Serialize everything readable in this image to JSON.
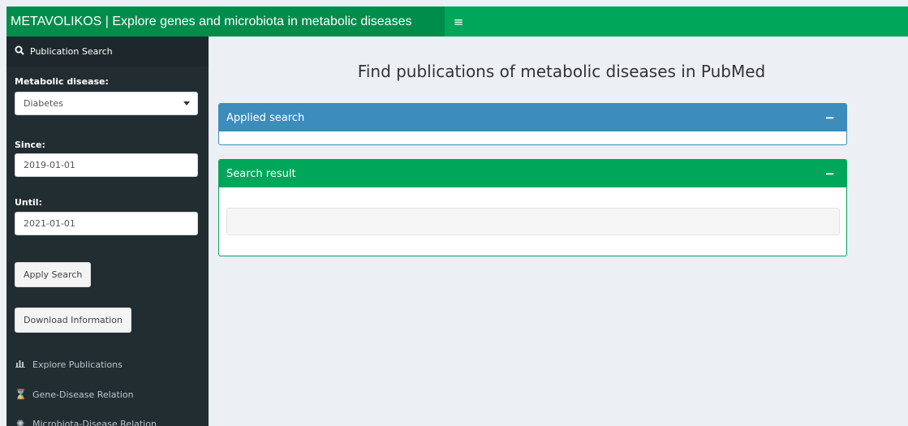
{
  "header": {
    "brand": "METAVOLIKOS | Explore genes and microbiota in metabolic diseases",
    "toggle_icon": "hamburger-icon",
    "colors": {
      "bar": "#00a65a",
      "brand_bg": "#008d4c"
    }
  },
  "sidebar": {
    "active_item": {
      "label": "Publication Search",
      "icon": "search-icon"
    },
    "disease": {
      "label": "Metabolic disease:",
      "value": "Diabetes"
    },
    "since": {
      "label": "Since:",
      "value": "2019-01-01"
    },
    "until": {
      "label": "Until:",
      "value": "2021-01-01"
    },
    "apply_button": "Apply Search",
    "download_button": "Download Information",
    "items": [
      {
        "label": "Explore Publications",
        "icon": "bar-chart-icon"
      },
      {
        "label": "Gene-Disease Relation",
        "icon": "hourglass-icon"
      },
      {
        "label": "Microbiota-Disease Relation",
        "icon": "microbe-icon"
      }
    ],
    "colors": {
      "bg": "#222d32",
      "active_bg": "#1e282c"
    }
  },
  "main": {
    "title": "Find publications of metabolic diseases in PubMed",
    "applied_panel": {
      "title": "Applied search",
      "collapse": "−",
      "color": "#3c8dbc"
    },
    "result_panel": {
      "title": "Search result",
      "collapse": "−",
      "color": "#00a65a"
    }
  }
}
